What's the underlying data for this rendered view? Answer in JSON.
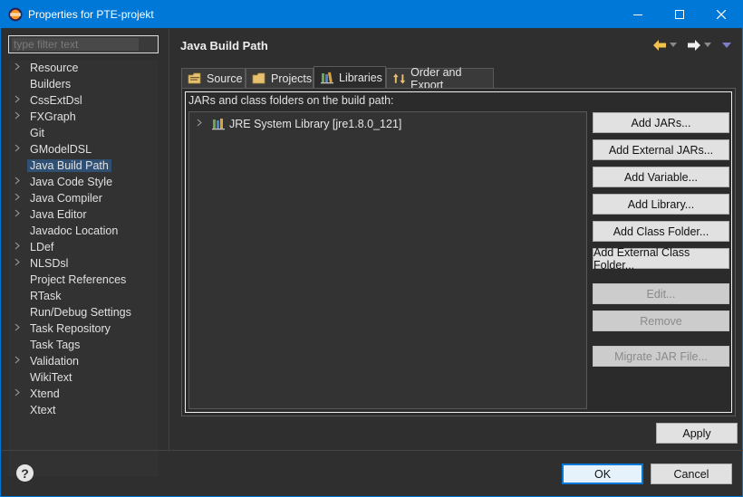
{
  "window": {
    "title": "Properties for PTE-projekt",
    "icon": "eclipse-icon",
    "accent": "#0078d7"
  },
  "filter": {
    "placeholder": "type filter text"
  },
  "sidebar": {
    "items": [
      {
        "label": "Resource",
        "expandable": true
      },
      {
        "label": "Builders",
        "expandable": false
      },
      {
        "label": "CssExtDsl",
        "expandable": true
      },
      {
        "label": "FXGraph",
        "expandable": true
      },
      {
        "label": "Git",
        "expandable": false
      },
      {
        "label": "GModelDSL",
        "expandable": true
      },
      {
        "label": "Java Build Path",
        "expandable": false,
        "selected": true
      },
      {
        "label": "Java Code Style",
        "expandable": true
      },
      {
        "label": "Java Compiler",
        "expandable": true
      },
      {
        "label": "Java Editor",
        "expandable": true
      },
      {
        "label": "Javadoc Location",
        "expandable": false
      },
      {
        "label": "LDef",
        "expandable": true
      },
      {
        "label": "NLSDsl",
        "expandable": true
      },
      {
        "label": "Project References",
        "expandable": false
      },
      {
        "label": "RTask",
        "expandable": false
      },
      {
        "label": "Run/Debug Settings",
        "expandable": false
      },
      {
        "label": "Task Repository",
        "expandable": true
      },
      {
        "label": "Task Tags",
        "expandable": false
      },
      {
        "label": "Validation",
        "expandable": true
      },
      {
        "label": "WikiText",
        "expandable": false
      },
      {
        "label": "Xtend",
        "expandable": true
      },
      {
        "label": "Xtext",
        "expandable": false
      }
    ],
    "selected_color": "#2f4f73"
  },
  "page": {
    "title": "Java Build Path"
  },
  "tabs": [
    {
      "label": "Source",
      "icon": "source-folder-icon"
    },
    {
      "label": "Projects",
      "icon": "projects-folder-icon"
    },
    {
      "label": "Libraries",
      "icon": "libraries-icon",
      "active": true
    },
    {
      "label": "Order and Export",
      "icon": "order-export-icon"
    }
  ],
  "libraries": {
    "label": "JARs and class folders on the build path:",
    "entries": [
      {
        "label": "JRE System Library [jre1.8.0_121]",
        "icon": "jre-library-icon"
      }
    ]
  },
  "buttons": {
    "add_jars": "Add JARs...",
    "add_external_jars": "Add External JARs...",
    "add_variable": "Add Variable...",
    "add_library": "Add Library...",
    "add_class_folder": "Add Class Folder...",
    "add_external_class_folder": "Add External Class Folder...",
    "edit": "Edit...",
    "remove": "Remove",
    "migrate_jar": "Migrate JAR File...",
    "apply": "Apply",
    "ok": "OK",
    "cancel": "Cancel"
  }
}
